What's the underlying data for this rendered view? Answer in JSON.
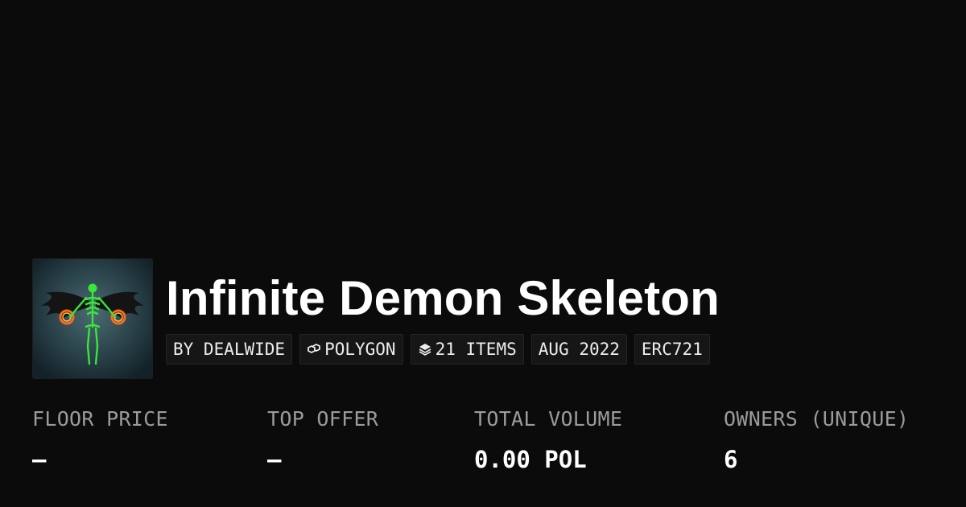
{
  "collection": {
    "title": "Infinite Demon Skeleton",
    "avatar_icon": "winged-green-skeleton-artwork"
  },
  "tags": {
    "creator": "BY DEALWIDE",
    "chain": "POLYGON",
    "chain_icon": "polygon-link-icon",
    "items": "21 ITEMS",
    "items_icon": "layers-icon",
    "date": "AUG 2022",
    "standard": "ERC721"
  },
  "stats": {
    "floor_price": {
      "label": "FLOOR PRICE",
      "value": "–"
    },
    "top_offer": {
      "label": "TOP OFFER",
      "value": "–"
    },
    "total_volume": {
      "label": "TOTAL VOLUME",
      "value": "0.00 POL"
    },
    "owners": {
      "label": "OWNERS (UNIQUE)",
      "value": "6"
    }
  },
  "colors": {
    "background": "#0b0b0b",
    "tag_background": "#161616",
    "label_gray": "#9b9b9b",
    "skeleton_green": "#39e639"
  }
}
